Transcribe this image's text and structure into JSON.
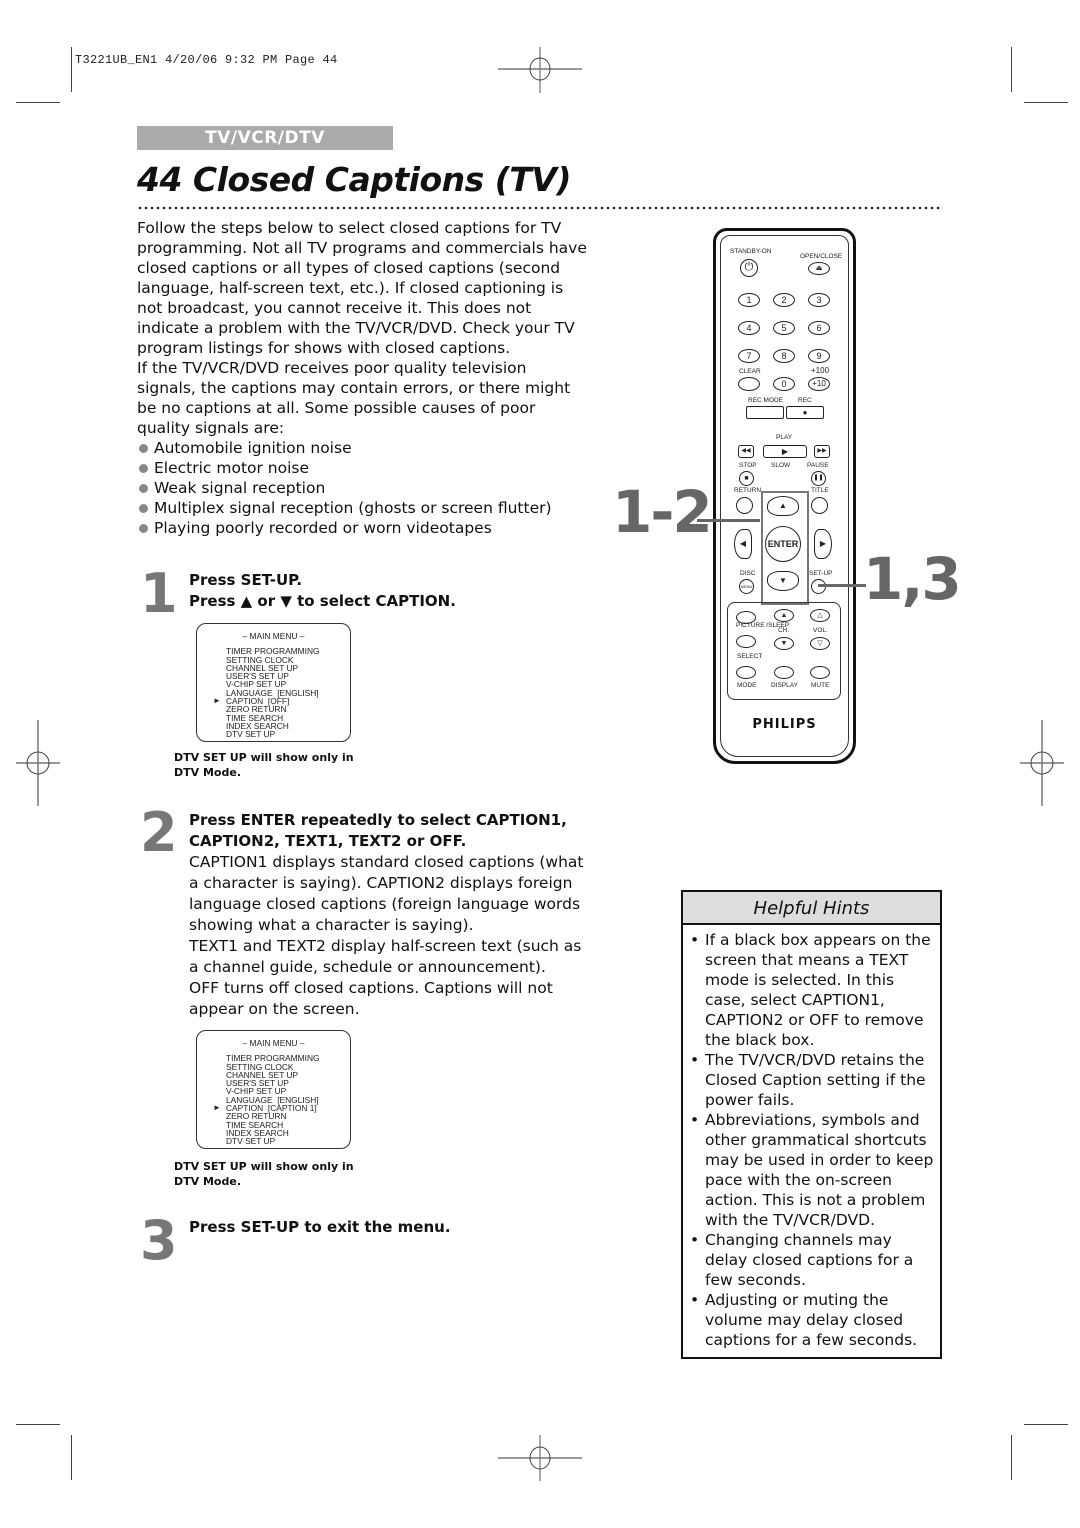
{
  "print_slug": "T3221UB_EN1  4/20/06  9:32 PM  Page 44",
  "section_tab": "TV/VCR/DTV",
  "page_title": "44  Closed Captions (TV)",
  "intro": {
    "paragraph1": "Follow the steps below to select closed captions for TV programming. Not all TV programs and commercials have closed captions or all types of closed captions (second language, half-screen text, etc.). If closed captioning is not broadcast, you cannot receive it. This does not indicate a problem with the TV/VCR/DVD. Check your TV program listings for shows with closed captions.",
    "paragraph2": "If the TV/VCR/DVD receives poor quality television signals, the captions may contain errors, or there might be no captions at all. Some possible causes of poor quality signals are:",
    "causes": [
      "Automobile ignition noise",
      "Electric motor noise",
      "Weak signal reception",
      "Multiplex signal reception (ghosts or screen flutter)",
      "Playing poorly recorded or worn videotapes"
    ]
  },
  "steps": [
    {
      "number": "1",
      "heading_line1": "Press SET-UP.",
      "heading_line2": "Press ▲ or ▼ to select CAPTION.",
      "osd": {
        "title": "– MAIN MENU –",
        "items": [
          "TIMER PROGRAMMING",
          "SETTING CLOCK",
          "CHANNEL SET UP",
          "USER'S SET UP",
          "V-CHIP SET UP",
          "LANGUAGE  [ENGLISH]",
          "CAPTION  [OFF]",
          "ZERO RETURN",
          "TIME SEARCH",
          "INDEX SEARCH",
          "DTV SET UP"
        ],
        "selected_index": 6
      },
      "note_line1": "DTV SET UP will show only in",
      "note_line2": "DTV Mode."
    },
    {
      "number": "2",
      "heading_line1": "Press ENTER repeatedly to select CAPTION1,",
      "heading_line2": "CAPTION2, TEXT1, TEXT2 or OFF.",
      "body1": "CAPTION1 displays standard closed captions (what a character is saying). CAPTION2 displays foreign language closed captions (foreign language words showing what a character is saying).",
      "body2": "TEXT1 and TEXT2 display half-screen text (such as a channel guide, schedule or announcement).",
      "body3": "OFF turns off closed captions. Captions will not appear on the screen.",
      "osd": {
        "title": "– MAIN MENU –",
        "items": [
          "TIMER PROGRAMMING",
          "SETTING CLOCK",
          "CHANNEL SET UP",
          "USER'S SET UP",
          "V-CHIP SET UP",
          "LANGUAGE  [ENGLISH]",
          "CAPTION  [CAPTION 1]",
          "ZERO RETURN",
          "TIME SEARCH",
          "INDEX SEARCH",
          "DTV SET UP"
        ],
        "selected_index": 6
      },
      "note_line1": "DTV SET UP will show only in",
      "note_line2": "DTV Mode."
    },
    {
      "number": "3",
      "heading_line1": "Press SET-UP to exit the menu."
    }
  ],
  "remote": {
    "brand": "PHILIPS",
    "labels": {
      "standby": "STANDBY-ON",
      "open_close": "OPEN/CLOSE",
      "clear": "CLEAR",
      "plus100": "+100",
      "plus10": "+10",
      "rec_mode": "REC MODE",
      "rec": "REC",
      "play": "PLAY",
      "stop": "STOP",
      "slow": "SLOW",
      "pause": "PAUSE",
      "return": "RETURN",
      "title": "TITLE",
      "enter": "ENTER",
      "disc": "DISC",
      "menu": "MENU",
      "setup": "SET-UP",
      "picture_sleep": "PICTURE /SLEEP",
      "ch": "CH.",
      "vol": "VOL.",
      "select": "SELECT",
      "mode": "MODE",
      "display": "DISPLAY",
      "mute": "MUTE"
    },
    "digits": [
      "1",
      "2",
      "3",
      "4",
      "5",
      "6",
      "7",
      "8",
      "9",
      "0"
    ],
    "callout_a": "1-2",
    "callout_b": "1,3"
  },
  "helpful_hints": {
    "title": "Helpful Hints",
    "items": [
      "If a black box appears on the screen that means a TEXT mode is selected. In this case, select CAPTION1, CAPTION2 or OFF to remove the black box.",
      "The TV/VCR/DVD retains the Closed Caption setting if the power fails.",
      "Abbreviations, symbols and other grammatical shortcuts may be used in order to keep pace with the on-screen action. This is not a problem with the TV/VCR/DVD.",
      "Changing channels may delay closed captions for a few seconds.",
      "Adjusting or muting the volume may delay closed captions for a few seconds."
    ]
  }
}
